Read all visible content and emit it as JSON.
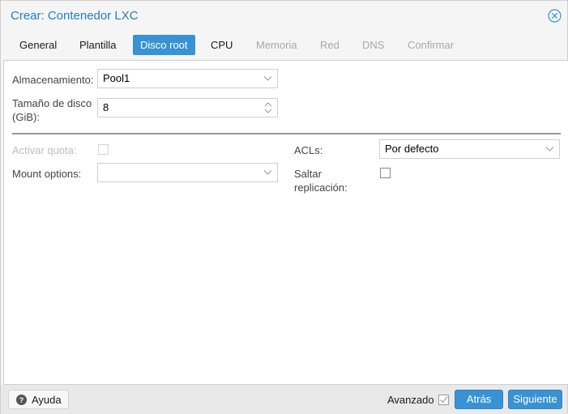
{
  "window": {
    "title": "Crear: Contenedor LXC",
    "close_icon": "close-circle-x-icon"
  },
  "tabs": [
    {
      "label": "General",
      "state": "enabled"
    },
    {
      "label": "Plantilla",
      "state": "enabled"
    },
    {
      "label": "Disco root",
      "state": "active"
    },
    {
      "label": "CPU",
      "state": "enabled"
    },
    {
      "label": "Memoria",
      "state": "disabled"
    },
    {
      "label": "Red",
      "state": "disabled"
    },
    {
      "label": "DNS",
      "state": "disabled"
    },
    {
      "label": "Confirmar",
      "state": "disabled"
    }
  ],
  "form": {
    "storage": {
      "label": "Almacenamiento:",
      "value": "Pool1"
    },
    "disk_size": {
      "label_line1": "Tamaño de disco",
      "label_line2": "(GiB):",
      "value": "8"
    },
    "quota": {
      "label": "Activar quota:",
      "checked": false,
      "disabled": true
    },
    "mount_options": {
      "label": "Mount options:",
      "value": ""
    },
    "acls": {
      "label": "ACLs:",
      "value": "Por defecto"
    },
    "skip_replication": {
      "label_line1": "Saltar",
      "label_line2": "replicación:",
      "checked": false
    }
  },
  "footer": {
    "help_label": "Ayuda",
    "advanced_label": "Avanzado",
    "advanced_checked": true,
    "back_label": "Atrás",
    "next_label": "Siguiente"
  },
  "colors": {
    "accent": "#3892d4",
    "title": "#1f7fc7",
    "disabled_text": "#a8a8a8"
  }
}
